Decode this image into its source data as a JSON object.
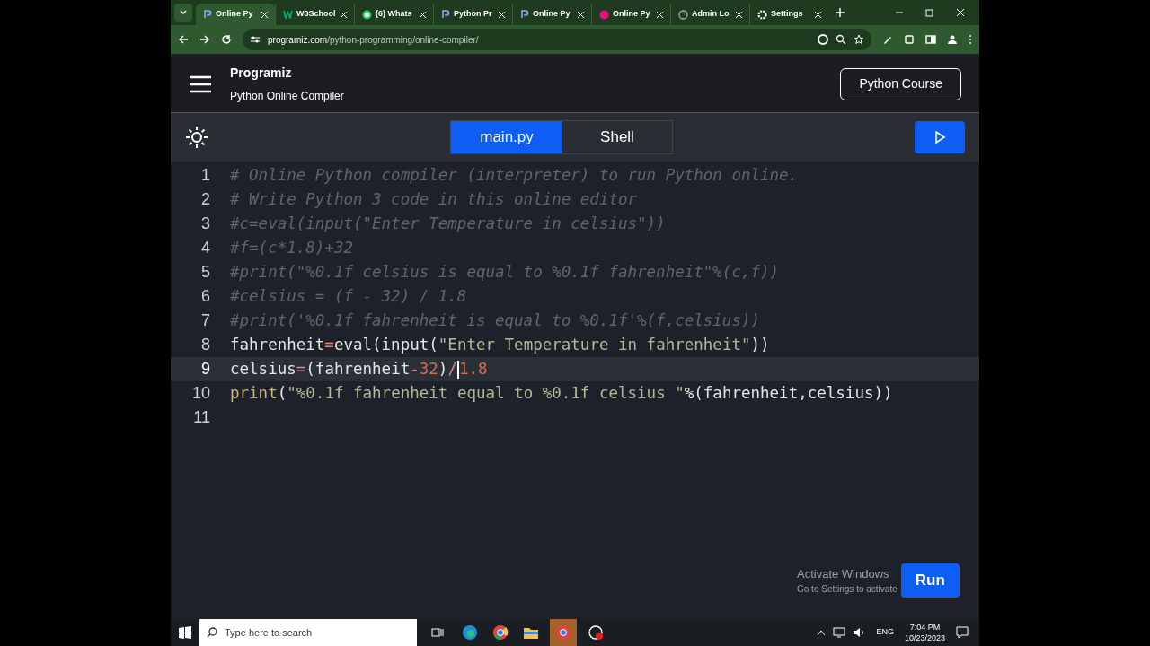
{
  "browser": {
    "tabs": [
      {
        "title": "Online Py",
        "selected": true
      },
      {
        "title": "W3School",
        "selected": false
      },
      {
        "title": "(6) Whats",
        "selected": false
      },
      {
        "title": "Python Pr",
        "selected": false
      },
      {
        "title": "Online Py",
        "selected": false
      },
      {
        "title": "Online Py",
        "selected": false
      },
      {
        "title": "Admin Lo",
        "selected": false
      },
      {
        "title": "Settings",
        "selected": false
      }
    ],
    "url_host": "programiz.com",
    "url_path": "/python-programming/online-compiler/"
  },
  "header": {
    "logo": "Programiz",
    "subtitle": "Python Online Compiler",
    "course_button": "Python Course"
  },
  "editor_tabs": [
    {
      "label": "main.py",
      "selected": true
    },
    {
      "label": "Shell",
      "selected": false
    }
  ],
  "code": [
    {
      "number": "1",
      "current": false,
      "tokens": [
        {
          "kind": "comment",
          "text": "# Online Python compiler (interpreter) to run Python online."
        }
      ]
    },
    {
      "number": "2",
      "current": false,
      "tokens": [
        {
          "kind": "comment",
          "text": "# Write Python 3 code in this online editor"
        }
      ]
    },
    {
      "number": "3",
      "current": false,
      "tokens": [
        {
          "kind": "comment",
          "text": "#c=eval(input(\"Enter Temperature in celsius\"))"
        }
      ]
    },
    {
      "number": "4",
      "current": false,
      "tokens": [
        {
          "kind": "comment",
          "text": "#f=(c*1.8)+32"
        }
      ]
    },
    {
      "number": "5",
      "current": false,
      "tokens": [
        {
          "kind": "comment",
          "text": "#print(\"%0.1f celsius is equal to %0.1f fahrenheit\"%(c,f))"
        }
      ]
    },
    {
      "number": "6",
      "current": false,
      "tokens": [
        {
          "kind": "comment",
          "text": "#celsius = (f - 32) / 1.8"
        }
      ]
    },
    {
      "number": "7",
      "current": false,
      "tokens": [
        {
          "kind": "comment",
          "text": "#print('%0.1f fahrenheit is equal to %0.1f'%(f,celsius))"
        }
      ]
    },
    {
      "number": "8",
      "current": false,
      "tokens": [
        {
          "kind": "name",
          "text": "fahrenheit"
        },
        {
          "kind": "op",
          "text": "="
        },
        {
          "kind": "name",
          "text": "eval(input("
        },
        {
          "kind": "string",
          "text": "\"Enter Temperature in fahrenheit\""
        },
        {
          "kind": "name",
          "text": "))"
        }
      ]
    },
    {
      "number": "9",
      "current": true,
      "tokens": [
        {
          "kind": "name",
          "text": "celsius"
        },
        {
          "kind": "op",
          "text": "="
        },
        {
          "kind": "name",
          "text": "(fahrenheit"
        },
        {
          "kind": "op",
          "text": "-"
        },
        {
          "kind": "number",
          "text": "32"
        },
        {
          "kind": "name",
          "text": ")"
        },
        {
          "kind": "op",
          "text": "/"
        },
        {
          "kind": "number",
          "text": "1.8"
        }
      ]
    },
    {
      "number": "10",
      "current": false,
      "tokens": [
        {
          "kind": "builtin",
          "text": "print"
        },
        {
          "kind": "name",
          "text": "("
        },
        {
          "kind": "string",
          "text": "\"%0.1f fahrenheit equal to %0.1f celsius \""
        },
        {
          "kind": "name",
          "text": "%(fahrenheit,celsius))"
        }
      ]
    },
    {
      "number": "11",
      "current": false
    }
  ],
  "run_button": "Run",
  "activation_notice": {
    "title": "Activate Windows",
    "detail": "Go to Settings to activate"
  },
  "taskbar": {
    "search_placeholder": "Type here to search",
    "language": "ENG",
    "time": "7:04 PM",
    "date": "10/23/2023"
  }
}
